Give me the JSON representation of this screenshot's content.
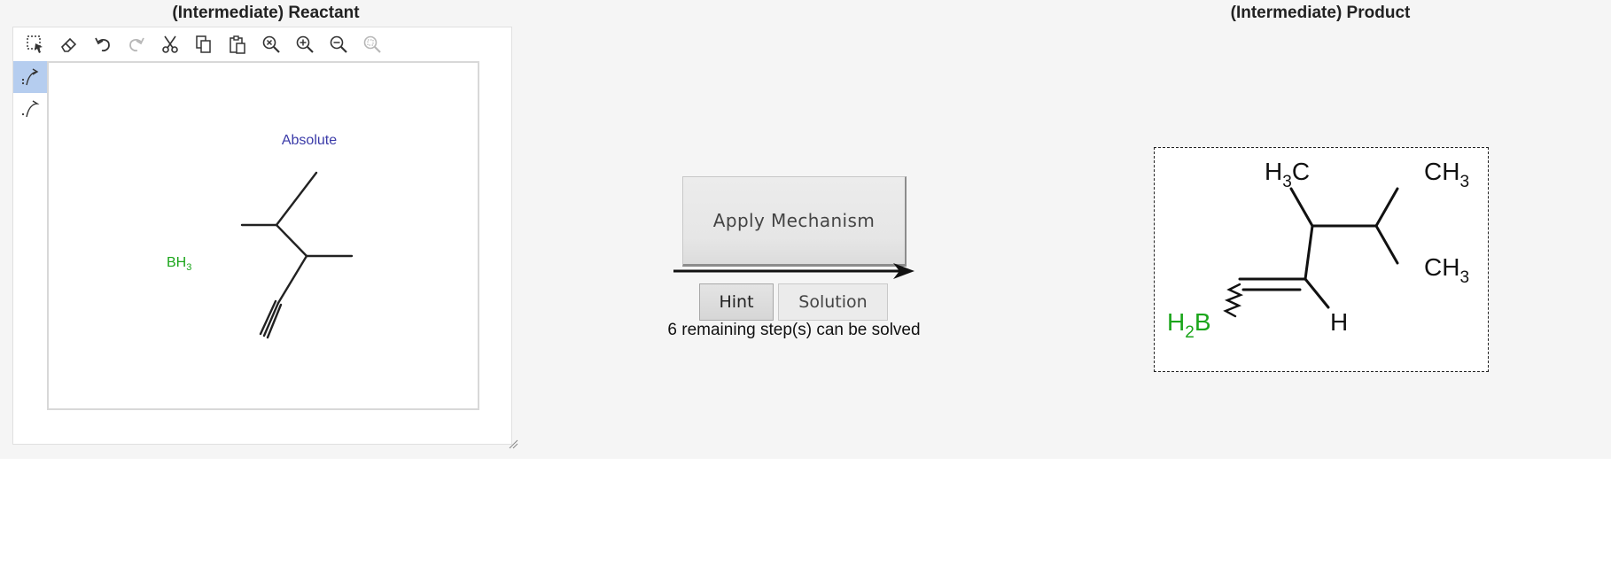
{
  "reactant_panel": {
    "title": "(Intermediate) Reactant",
    "toolbar": [
      {
        "name": "select-tool",
        "icon": "lasso-select-icon"
      },
      {
        "name": "erase-tool",
        "icon": "eraser-icon"
      },
      {
        "name": "undo-tool",
        "icon": "undo-icon"
      },
      {
        "name": "redo-tool",
        "icon": "redo-icon",
        "disabled": true
      },
      {
        "name": "cut-tool",
        "icon": "scissors-icon"
      },
      {
        "name": "copy-tool",
        "icon": "copy-icon"
      },
      {
        "name": "paste-tool",
        "icon": "paste-icon"
      },
      {
        "name": "zoom-reset-tool",
        "icon": "zoom-clear-icon"
      },
      {
        "name": "zoom-in-tool",
        "icon": "zoom-in-icon"
      },
      {
        "name": "zoom-out-tool",
        "icon": "zoom-out-icon"
      },
      {
        "name": "zoom-fit-tool",
        "icon": "zoom-fit-icon",
        "disabled": true
      }
    ],
    "side_tools": [
      {
        "name": "electron-pair-arrow-tool",
        "icon": "curved-arrow-pair-icon",
        "active": true
      },
      {
        "name": "single-electron-arrow-tool",
        "icon": "curved-arrow-single-icon",
        "active": false
      }
    ],
    "canvas": {
      "stereo_label": "Absolute",
      "reagent": {
        "text": "BH",
        "subscript": "3",
        "color": "#1aa51a"
      }
    }
  },
  "mechanism": {
    "apply_button": "Apply Mechanism",
    "hint_button": "Hint",
    "solution_button": "Solution",
    "status": "6 remaining step(s) can be solved"
  },
  "product_panel": {
    "title": "(Intermediate) Product",
    "labels": {
      "methyl_top_left": {
        "main": "H",
        "sub": "3",
        "tail": "C"
      },
      "methyl_top_right": {
        "main": "CH",
        "sub": "3"
      },
      "methyl_right": {
        "main": "CH",
        "sub": "3"
      },
      "boron": {
        "main": "H",
        "sub": "2",
        "tail": "B",
        "color": "#1aa51a"
      },
      "hydrogen": "H"
    }
  },
  "colors": {
    "panel_bg": "#f5f5f5",
    "stereo_label": "#3a3aa8",
    "boron_green": "#1aa51a",
    "active_tool": "#b5cdef"
  }
}
